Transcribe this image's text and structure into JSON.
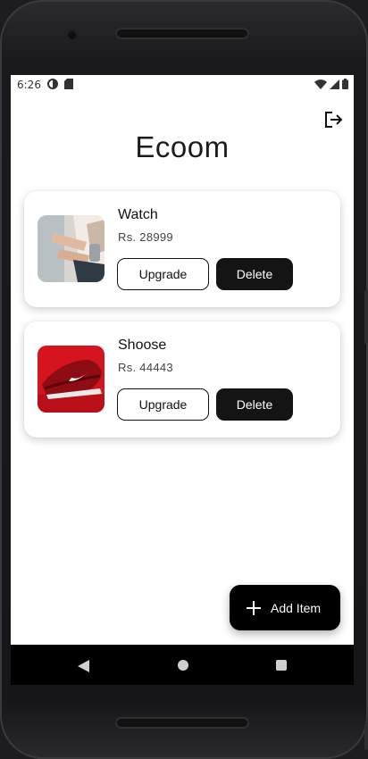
{
  "status_bar": {
    "time": "6:26"
  },
  "header": {
    "title": "Ecoom"
  },
  "products": [
    {
      "name": "Watch",
      "price": "Rs. 28999",
      "upgrade_label": "Upgrade",
      "delete_label": "Delete"
    },
    {
      "name": "Shoose",
      "price": "Rs. 44443",
      "upgrade_label": "Upgrade",
      "delete_label": "Delete"
    }
  ],
  "fab": {
    "label": "Add Item"
  },
  "colors": {
    "accent": "#000000",
    "delete_bg": "#141414",
    "background": "#ffffff"
  },
  "icons": [
    "logout-icon",
    "plus-icon",
    "nav-back-icon",
    "nav-home-icon",
    "nav-recents-icon",
    "wifi-icon",
    "signal-icon",
    "battery-icon"
  ]
}
